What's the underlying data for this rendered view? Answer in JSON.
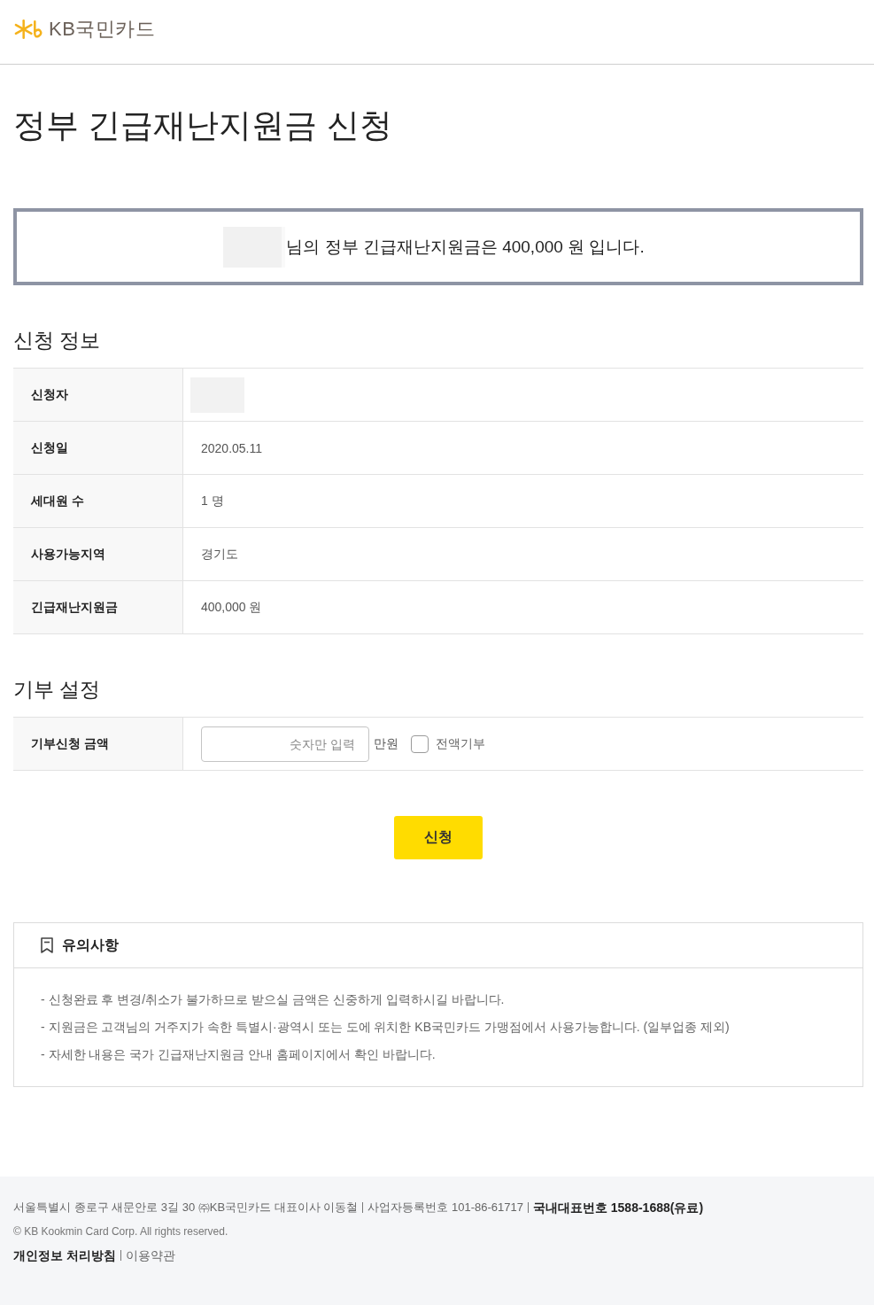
{
  "header": {
    "logo_text": "KB국민카드"
  },
  "page_title": "정부 긴급재난지원금 신청",
  "summary": {
    "message": "님의 정부 긴급재난지원금은 400,000 원 입니다."
  },
  "application_info": {
    "heading": "신청 정보",
    "rows": [
      {
        "label": "신청자",
        "kind": "redacted"
      },
      {
        "label": "신청일",
        "kind": "text",
        "value": "2020.05.11"
      },
      {
        "label": "세대원 수",
        "kind": "text",
        "value": "1 명"
      },
      {
        "label": "사용가능지역",
        "kind": "text",
        "value": "경기도"
      },
      {
        "label": "긴급재난지원금",
        "kind": "text",
        "value": "400,000 원"
      }
    ]
  },
  "donation": {
    "heading": "기부 설정",
    "label": "기부신청 금액",
    "input": {
      "placeholder": "숫자만 입력"
    },
    "unit": "만원",
    "full_donation": {
      "label": "전액기부",
      "checked": false
    }
  },
  "submit_button": "신청",
  "notice": {
    "title": "유의사항",
    "items": [
      "- 신청완료 후 변경/취소가 불가하므로 받으실 금액은 신중하게 입력하시길 바랍니다.",
      "- 지원금은 고객님의 거주지가 속한 특별시·광역시 또는 도에 위치한 KB국민카드 가맹점에서 사용가능합니다. (일부업종 제외)",
      "- 자세한 내용은 국가 긴급재난지원금 안내 홈페이지에서 확인 바랍니다."
    ]
  },
  "footer": {
    "info": [
      {
        "text": "서울특별시 종로구 새문안로 3길 30 ㈜KB국민카드 대표이사 이동철",
        "bold": false
      },
      {
        "text": "사업자등록번호 101-86-61717",
        "bold": false
      },
      {
        "text": "국내대표번호 1588-1688(유료)",
        "bold": true
      }
    ],
    "copyright": "© KB Kookmin Card Corp. All rights reserved.",
    "links": [
      {
        "label": "개인정보 처리방침",
        "bold": true
      },
      {
        "label": "이용약관",
        "bold": false
      }
    ]
  }
}
